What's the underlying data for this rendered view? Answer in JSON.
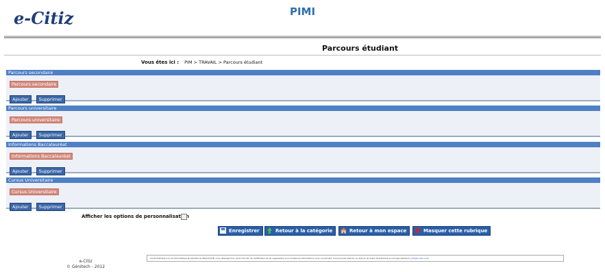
{
  "header": {
    "logo_text": "e-Citiz",
    "app_name": "PIMI"
  },
  "page": {
    "title": "Parcours étudiant"
  },
  "breadcrumb": {
    "label": "Vous êtes ici :",
    "path": "PIM > TRAVAIL > Parcours étudiant"
  },
  "sections": [
    {
      "title": "Parcours secondaire",
      "item": "Parcours secondaire",
      "add_label": "Ajouter",
      "delete_label": "Supprimer"
    },
    {
      "title": "Parcours universitaire",
      "item": "Parcours universitaire",
      "add_label": "Ajouter",
      "delete_label": "Supprimer"
    },
    {
      "title": "Informations Baccalauréat",
      "item": "Informations Baccalauréat",
      "add_label": "Ajouter",
      "delete_label": "Supprimer"
    },
    {
      "title": "Cursus Universitaire",
      "item": "Cursus Universitaire",
      "add_label": "Ajouter",
      "delete_label": "Supprimer"
    }
  ],
  "personalisation": {
    "label": "Afficher les options de personnalisation",
    "checked": false
  },
  "actions": {
    "save": "Enregistrer",
    "back_category": "Retour à la catégorie",
    "back_space": "Retour à mon espace",
    "hide_section": "Masquer cette rubrique"
  },
  "footer": {
    "brand": "e-Citiz",
    "copyright": "© Génitech - 2012",
    "legal_text": "Conformément à la loi Informatique et Libertés du 06/01/1978, vous disposez d'un droit d'accès, de rectification et de suppression pour toutes les informations vous concernant. Vous pouvez exercer ce droit en écrivant directement au Groupe Génitech",
    "legal_link": "(info@e-citiz.com)"
  },
  "colors": {
    "section_header": "#4f80c4",
    "item_highlight": "#d38b7d",
    "button": "#3b67a6",
    "title_blue": "#2e6fb0"
  },
  "icons": [
    "save-icon",
    "up-arrow-icon",
    "home-icon",
    "close-icon"
  ]
}
